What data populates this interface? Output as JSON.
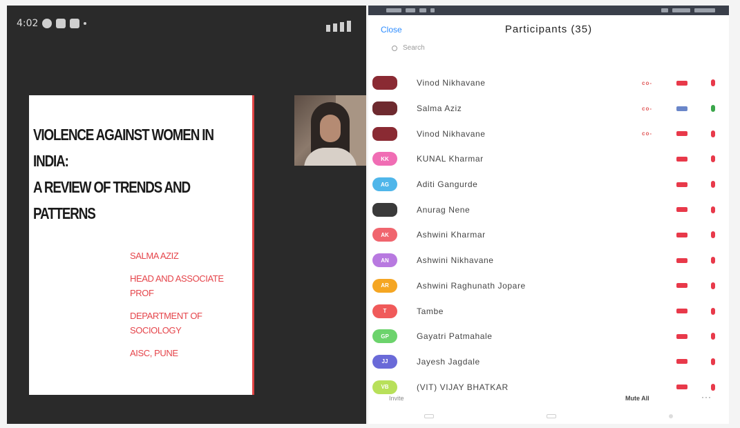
{
  "left": {
    "status_time": "4:02",
    "slide": {
      "title_lines": [
        "VIOLENCE AGAINST WOMEN IN",
        "INDIA:",
        "A REVIEW OF TRENDS AND",
        "PATTERNS"
      ],
      "author": "SALMA AZIZ",
      "role": "HEAD AND ASSOCIATE PROF",
      "dept": "DEPARTMENT OF SOCIOLOGY",
      "college": "AISC, PUNE"
    }
  },
  "participants_panel": {
    "close_label": "Close",
    "title": "Participants (35)",
    "search_placeholder": "Search",
    "items": [
      {
        "name": "Vinod Nikhavane",
        "initials": "",
        "avatar_color": "#8a2a33",
        "photo": true,
        "host": "co-",
        "video": "on",
        "mic": "on"
      },
      {
        "name": "Salma Aziz",
        "initials": "",
        "avatar_color": "#6e2a2f",
        "photo": true,
        "host": "co-",
        "video": "off",
        "mic": "green"
      },
      {
        "name": "Vinod Nikhavane",
        "initials": "",
        "avatar_color": "#8a2a33",
        "photo": true,
        "host": "co-",
        "video": "on",
        "mic": "on"
      },
      {
        "name": "KUNAL Kharmar",
        "initials": "KK",
        "avatar_color": "#f06db4",
        "photo": false,
        "host": "",
        "video": "on",
        "mic": "on"
      },
      {
        "name": "Aditi Gangurde",
        "initials": "AG",
        "avatar_color": "#4fb6ea",
        "photo": false,
        "host": "",
        "video": "on",
        "mic": "on"
      },
      {
        "name": "Anurag Nene",
        "initials": "",
        "avatar_color": "#3a3a3a",
        "photo": true,
        "host": "",
        "video": "on",
        "mic": "on"
      },
      {
        "name": "Ashwini Kharmar",
        "initials": "AK",
        "avatar_color": "#f0656e",
        "photo": false,
        "host": "",
        "video": "on",
        "mic": "on"
      },
      {
        "name": "Ashwini Nikhavane",
        "initials": "AN",
        "avatar_color": "#b879e0",
        "photo": false,
        "host": "",
        "video": "on",
        "mic": "on"
      },
      {
        "name": "Ashwini Raghunath Jopare",
        "initials": "AR",
        "avatar_color": "#f5a623",
        "photo": false,
        "host": "",
        "video": "on",
        "mic": "on"
      },
      {
        "name": "Tambe",
        "initials": "T",
        "avatar_color": "#f05a5a",
        "photo": false,
        "host": "",
        "video": "on",
        "mic": "on"
      },
      {
        "name": "Gayatri Patmahale",
        "initials": "GP",
        "avatar_color": "#6cd36c",
        "photo": false,
        "host": "",
        "video": "on",
        "mic": "on"
      },
      {
        "name": "Jayesh Jagdale",
        "initials": "JJ",
        "avatar_color": "#6a6ad8",
        "photo": false,
        "host": "",
        "video": "on",
        "mic": "on"
      },
      {
        "name": "(VIT) VIJAY BHATKAR",
        "initials": "VB",
        "avatar_color": "#b8e05a",
        "photo": false,
        "host": "",
        "video": "on",
        "mic": "on"
      }
    ],
    "invite_label": "Invite",
    "mute_all_label": "Mute All",
    "more_label": "···"
  }
}
